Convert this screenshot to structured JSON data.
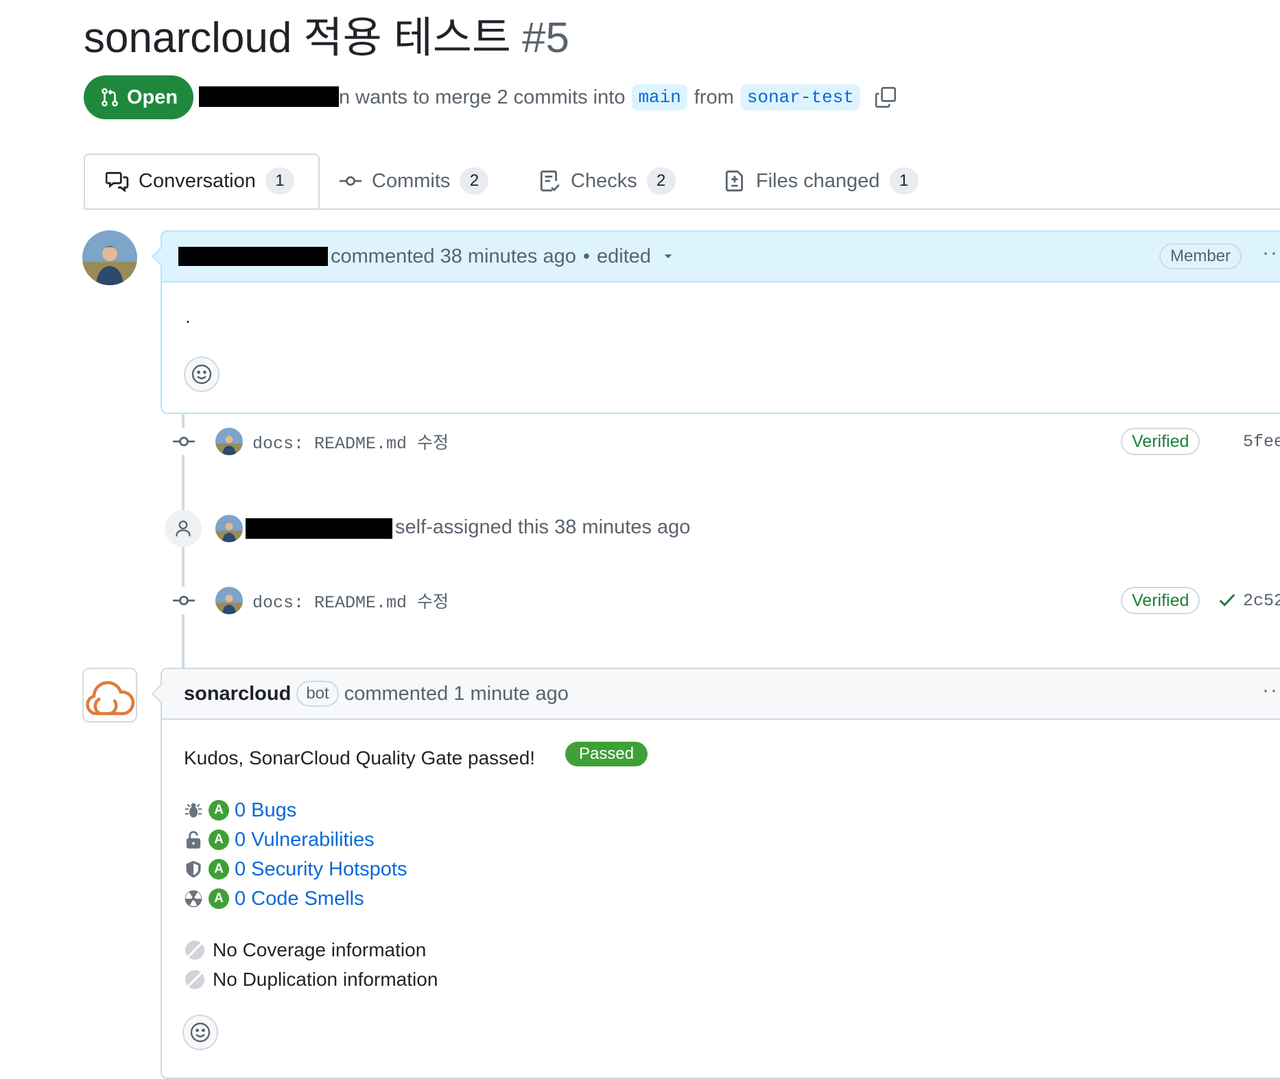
{
  "pr": {
    "title": "sonarcloud 적용 테스트",
    "number": "#5",
    "state": "Open",
    "merge_text_tail": "n wants to merge 2 commits into",
    "base_branch": "main",
    "from_text": "from",
    "head_branch": "sonar-test"
  },
  "tabs": [
    {
      "label": "Conversation",
      "count": "1",
      "icon": "comment-discussion-icon"
    },
    {
      "label": "Commits",
      "count": "2",
      "icon": "git-commit-icon"
    },
    {
      "label": "Checks",
      "count": "2",
      "icon": "checklist-icon"
    },
    {
      "label": "Files changed",
      "count": "1",
      "icon": "file-diff-icon"
    }
  ],
  "comment1": {
    "meta": "commented 38 minutes ago",
    "separator": "•",
    "edited": "edited",
    "role": "Member",
    "body": "."
  },
  "timeline": {
    "commit1": {
      "message": "docs: README.md 수정",
      "verified": "Verified",
      "sha": "5fee"
    },
    "assign_event": {
      "text": "self-assigned this 38 minutes ago"
    },
    "commit2": {
      "message": "docs: README.md 수정",
      "verified": "Verified",
      "sha": "2c52"
    }
  },
  "comment2": {
    "author": "sonarcloud",
    "bot_label": "bot",
    "meta": "commented 1 minute ago",
    "headline": "Kudos, SonarCloud Quality Gate passed!",
    "status": "Passed",
    "metrics": [
      {
        "icon": "bug-icon",
        "grade": "A",
        "label": "0 Bugs"
      },
      {
        "icon": "unlock-icon",
        "grade": "A",
        "label": "0 Vulnerabilities"
      },
      {
        "icon": "shield-icon",
        "grade": "A",
        "label": "0 Security Hotspots"
      },
      {
        "icon": "code-smell-icon",
        "grade": "A",
        "label": "0 Code Smells"
      }
    ],
    "coverage": "No Coverage information",
    "duplication": "No Duplication information"
  },
  "colors": {
    "open_green": "#1f883d",
    "link_blue": "#0969da",
    "sonar_grade_green": "#3fa037",
    "verified_green": "#1a7f37",
    "sonar_orange": "#e07b39"
  }
}
